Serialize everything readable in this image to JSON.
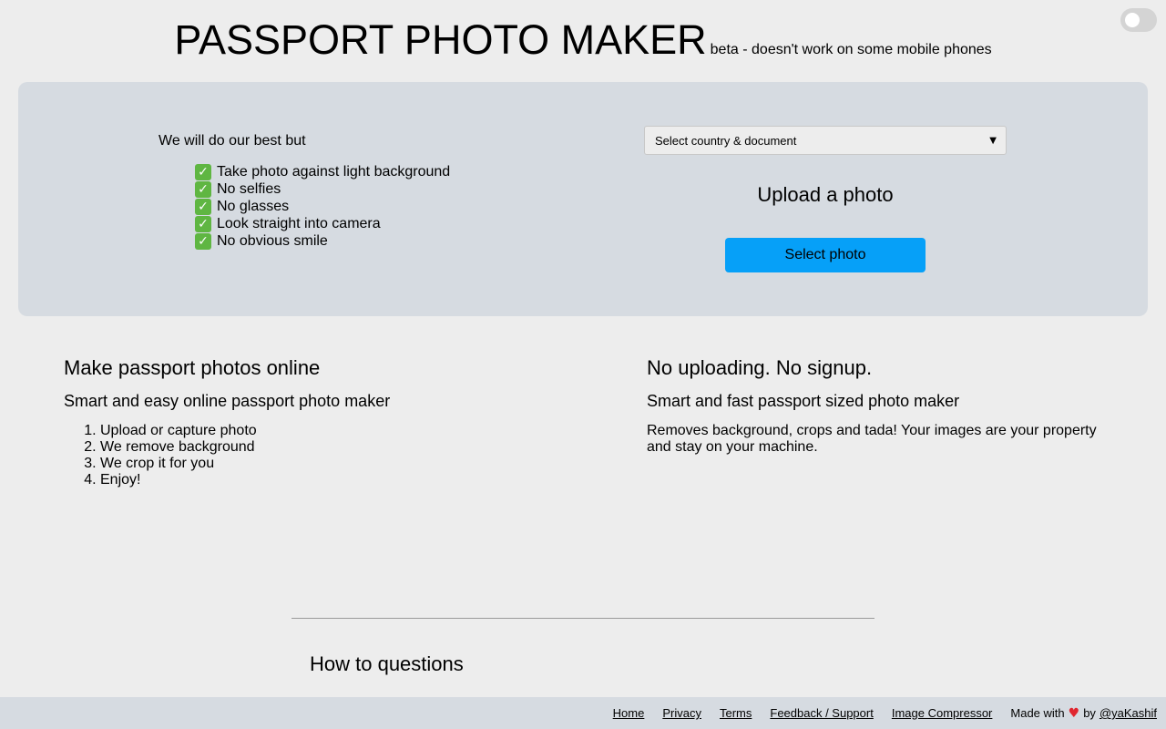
{
  "header": {
    "title": "PASSPORT PHOTO MAKER",
    "subtitle": "beta - doesn't work on some mobile phones"
  },
  "toggle": {
    "state": "off"
  },
  "panel": {
    "intro": "We will do our best but",
    "tips": [
      "Take photo against light background",
      "No selfies",
      "No glasses",
      "Look straight into camera",
      "No obvious smile"
    ],
    "select": {
      "selected": "Select country & document"
    },
    "upload_heading": "Upload a photo",
    "select_button": "Select photo"
  },
  "info_left": {
    "heading": "Make passport photos online",
    "subheading": "Smart and easy online passport photo maker",
    "steps": [
      "Upload or capture photo",
      "We remove background",
      "We crop it for you",
      "Enjoy!"
    ]
  },
  "info_right": {
    "heading": "No uploading. No signup.",
    "subheading": "Smart and fast passport sized photo maker",
    "text": "Removes background, crops and tada! Your images are your property and stay on your machine."
  },
  "howto": "How to questions",
  "footer": {
    "links": [
      "Home",
      "Privacy",
      "Terms",
      "Feedback / Support",
      "Image Compressor"
    ],
    "made_with": "Made with",
    "by": "by",
    "author": "@yaKashif"
  },
  "colors": {
    "page_bg": "#ededed",
    "panel_bg": "#d6dbe1",
    "button_bg": "#06a0f8",
    "check_bg": "#5fb642",
    "heart": "#e0262f"
  },
  "icons": [
    "toggle-switch",
    "check-mark-icon",
    "chevron-down-icon",
    "heart-icon"
  ]
}
